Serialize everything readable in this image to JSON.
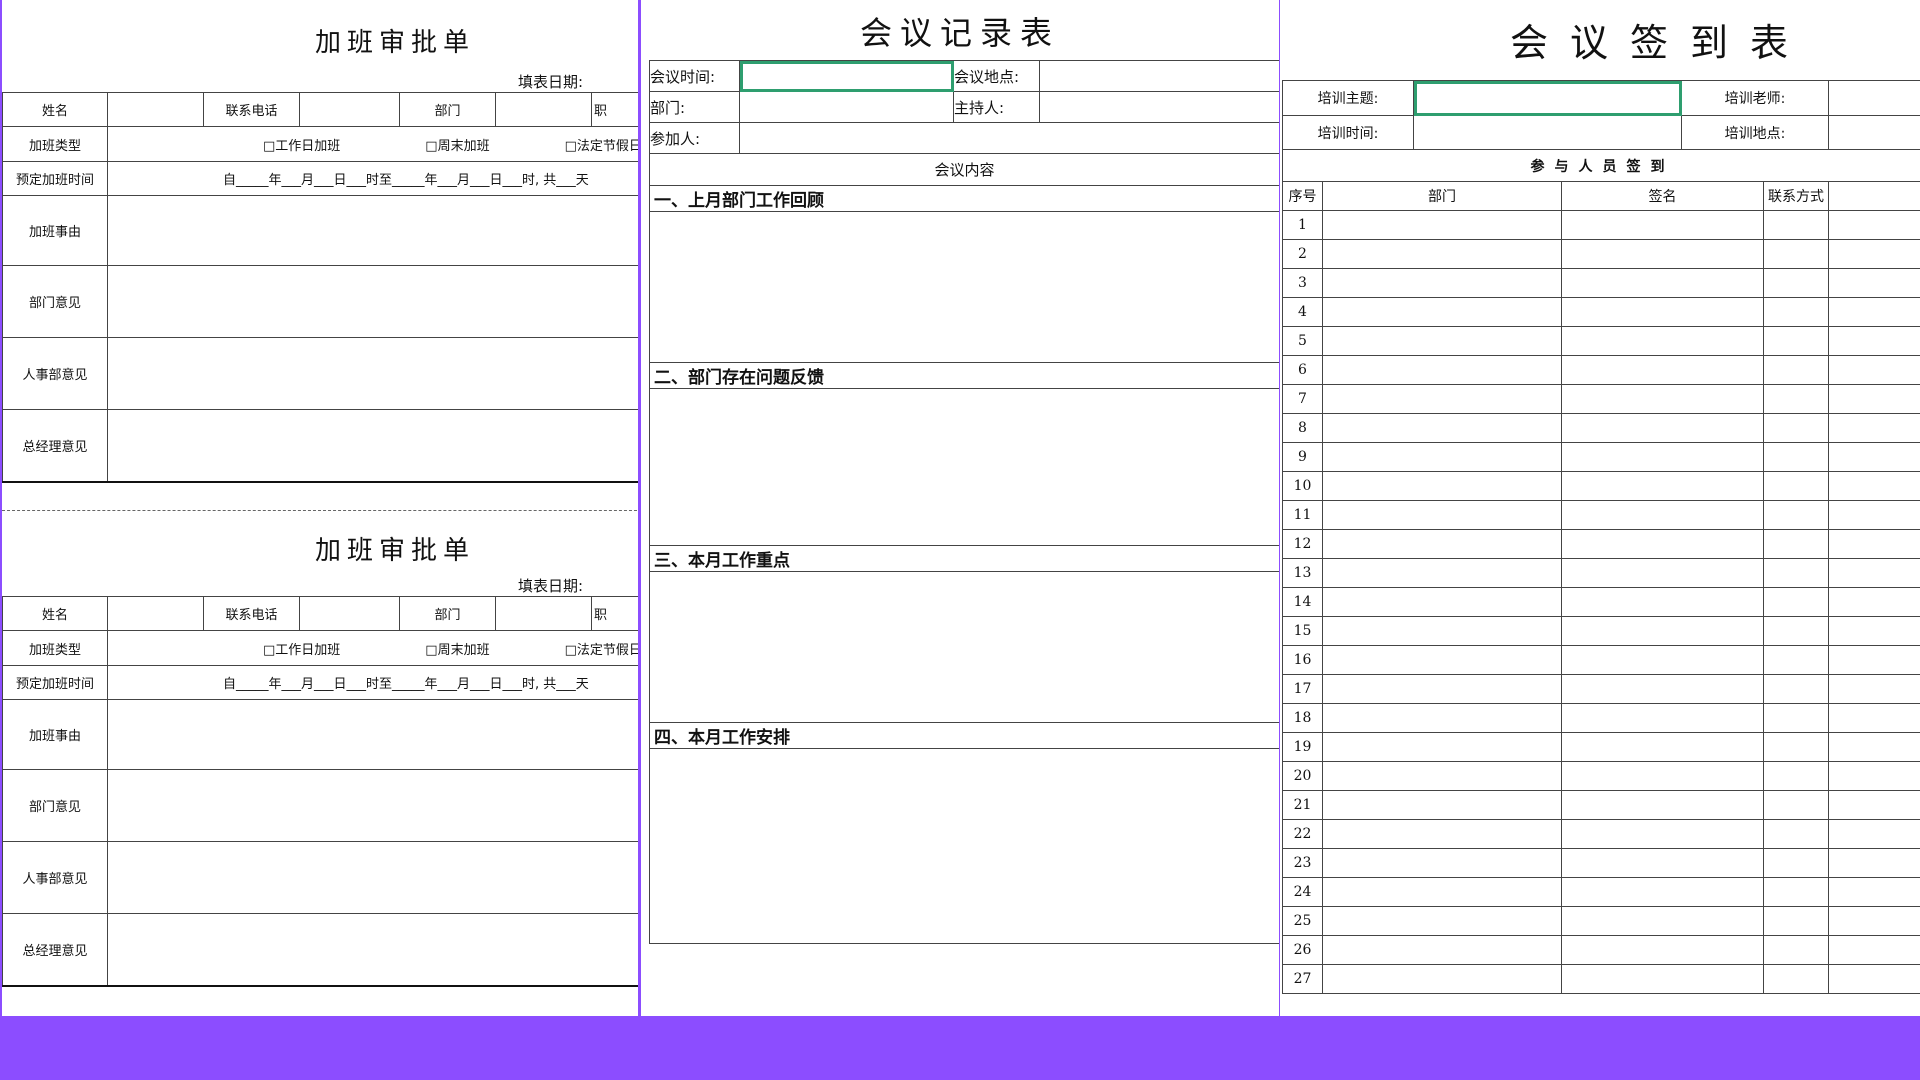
{
  "overtime": {
    "title": "加班审批单",
    "fill_date": "填表日期:",
    "name": "姓名",
    "phone": "联系电话",
    "dept": "部门",
    "position_cut": "职",
    "type_label": "加班类型",
    "opt_workday": "□工作日加班",
    "opt_weekend": "□周末加班",
    "opt_holiday": "□法定节假日",
    "time_label": "预定加班时间",
    "time_text": "自_____年___月___日___时至_____年___月___日___时, 共___天",
    "reason": "加班事由",
    "dept_opinion": "部门意见",
    "hr_opinion": "人事部意见",
    "gm_opinion": "总经理意见"
  },
  "meeting": {
    "title": "会议记录表",
    "time": "会议时间:",
    "place": "会议地点:",
    "dept": "部门:",
    "host": "主持人:",
    "attendees": "参加人:",
    "content": "会议内容",
    "sec1": "一、上月部门工作回顾",
    "sec2": "二、部门存在问题反馈",
    "sec3": "三、本月工作重点",
    "sec4": "四、本月工作安排"
  },
  "signin": {
    "title": "会议签到表",
    "topic": "培训主题:",
    "teacher": "培训老师:",
    "time": "培训时间:",
    "place": "培训地点:",
    "section": "参与人员签到",
    "col_no": "序号",
    "col_dept": "部门",
    "col_sign": "签名",
    "col_contact": "联系方式",
    "rows": [
      "1",
      "2",
      "3",
      "4",
      "5",
      "6",
      "7",
      "8",
      "9",
      "10",
      "11",
      "12",
      "13",
      "14",
      "15",
      "16",
      "17",
      "18",
      "19",
      "20",
      "21",
      "22",
      "23",
      "24",
      "25",
      "26",
      "27"
    ]
  }
}
